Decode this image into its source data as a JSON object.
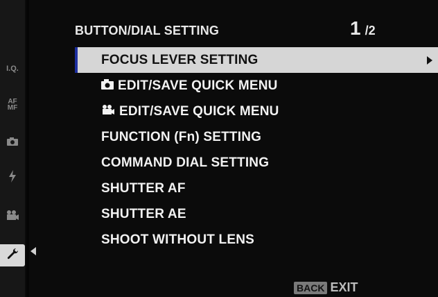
{
  "header": {
    "title": "BUTTON/DIAL SETTING",
    "page_current": "1",
    "page_total": "2"
  },
  "sidebar": {
    "items": [
      {
        "label": "I.Q."
      },
      {
        "label": "AF\nMF"
      },
      {
        "label": "camera"
      },
      {
        "label": "flash"
      },
      {
        "label": "movie"
      },
      {
        "label": "wrench"
      }
    ]
  },
  "menu": {
    "items": [
      {
        "label": "FOCUS LEVER SETTING",
        "selected": true
      },
      {
        "label": "EDIT/SAVE QUICK MENU",
        "icon": "camera-icon"
      },
      {
        "label": "EDIT/SAVE QUICK MENU",
        "icon": "movie-camera-icon"
      },
      {
        "label": "FUNCTION (Fn) SETTING"
      },
      {
        "label": "COMMAND DIAL SETTING"
      },
      {
        "label": "SHUTTER AF"
      },
      {
        "label": "SHUTTER AE"
      },
      {
        "label": "SHOOT WITHOUT LENS"
      }
    ]
  },
  "footer": {
    "back_label": "BACK",
    "exit_label": "EXIT"
  },
  "colors": {
    "selection_bg": "#d6d6d6",
    "selection_accent": "#1d2fa0",
    "text": "#f2f2f2",
    "background": "#0b0b0b"
  }
}
